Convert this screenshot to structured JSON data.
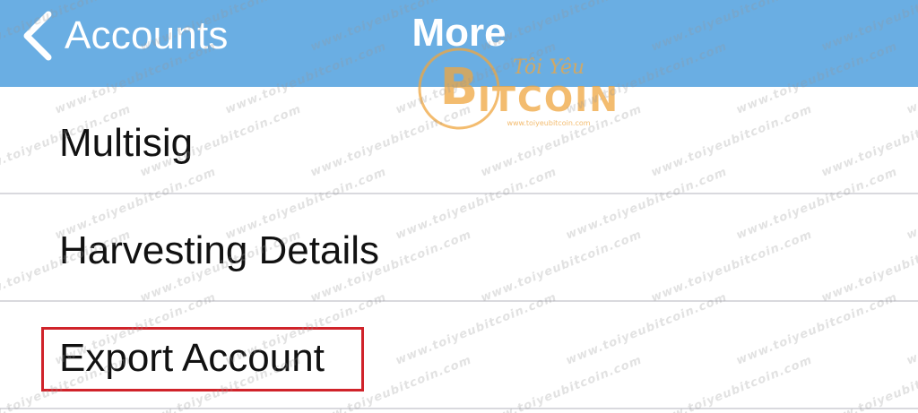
{
  "navbar": {
    "back_label": "Accounts",
    "title": "More",
    "background_color": "#6aaee3"
  },
  "icons": {
    "back": "chevron-left-icon"
  },
  "menu": {
    "items": [
      {
        "label": "Multisig"
      },
      {
        "label": "Harvesting Details"
      },
      {
        "label": "Export Account",
        "highlighted": true
      }
    ]
  },
  "watermark": {
    "text": "www.toiyeubitcoin.com",
    "logo_text": "BITCOIN",
    "logo_subtext": "Tôi Yêu"
  },
  "colors": {
    "highlight_border": "#d0232a",
    "separator": "#d9d9de",
    "logo_orange": "#f0a640"
  }
}
